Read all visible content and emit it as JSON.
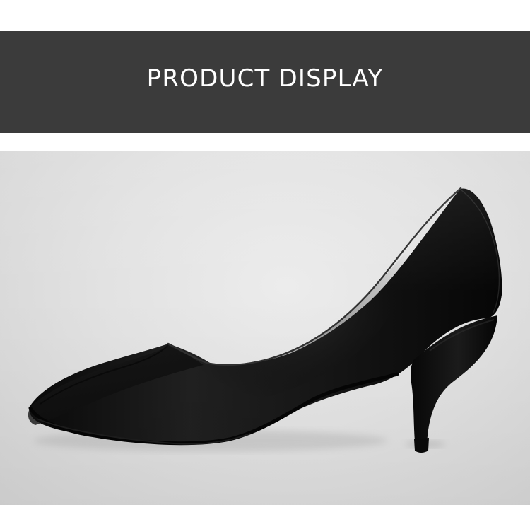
{
  "header": {
    "title": "PRODUCT DISPLAY"
  },
  "colors": {
    "banner_background": "#3b3b3b",
    "banner_text": "#ffffff",
    "page_background": "#ffffff",
    "photo_background": "#e2e2e2",
    "shoe_black": "#111111"
  },
  "image": {
    "subject_icon": "black-pointed-toe-high-heel-pump"
  }
}
